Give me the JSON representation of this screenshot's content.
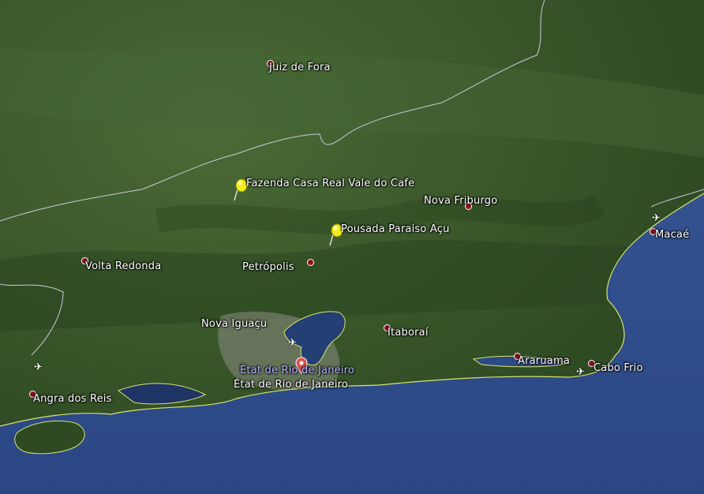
{
  "map": {
    "colors": {
      "land": "#3b5a2c",
      "land_dark": "#2c4a22",
      "ocean": "#2f4f8e",
      "coast": "#d9e36a",
      "border": "#c8ccd8",
      "urban": "#8c8f86"
    },
    "places": [
      {
        "name": "Juiz de Fora",
        "kind": "city"
      },
      {
        "name": "Fazenda Casa Real Vale do Cafe",
        "kind": "pushpin"
      },
      {
        "name": "Nova Friburgo",
        "kind": "city"
      },
      {
        "name": "Pousada Paraiso Açu",
        "kind": "pushpin"
      },
      {
        "name": "Volta Redonda",
        "kind": "city"
      },
      {
        "name": "Petrópolis",
        "kind": "city"
      },
      {
        "name": "Macaé",
        "kind": "city"
      },
      {
        "name": "Nova Iguaçu",
        "kind": "city"
      },
      {
        "name": "Itaboraí",
        "kind": "city"
      },
      {
        "name": "Araruama",
        "kind": "city"
      },
      {
        "name": "Cabo Frio",
        "kind": "city"
      },
      {
        "name": "État de Rio de Janeiro",
        "kind": "search-result"
      },
      {
        "name": "État de Rio de Janeiro",
        "kind": "region"
      },
      {
        "name": "Angra dos Reis",
        "kind": "city"
      }
    ]
  }
}
